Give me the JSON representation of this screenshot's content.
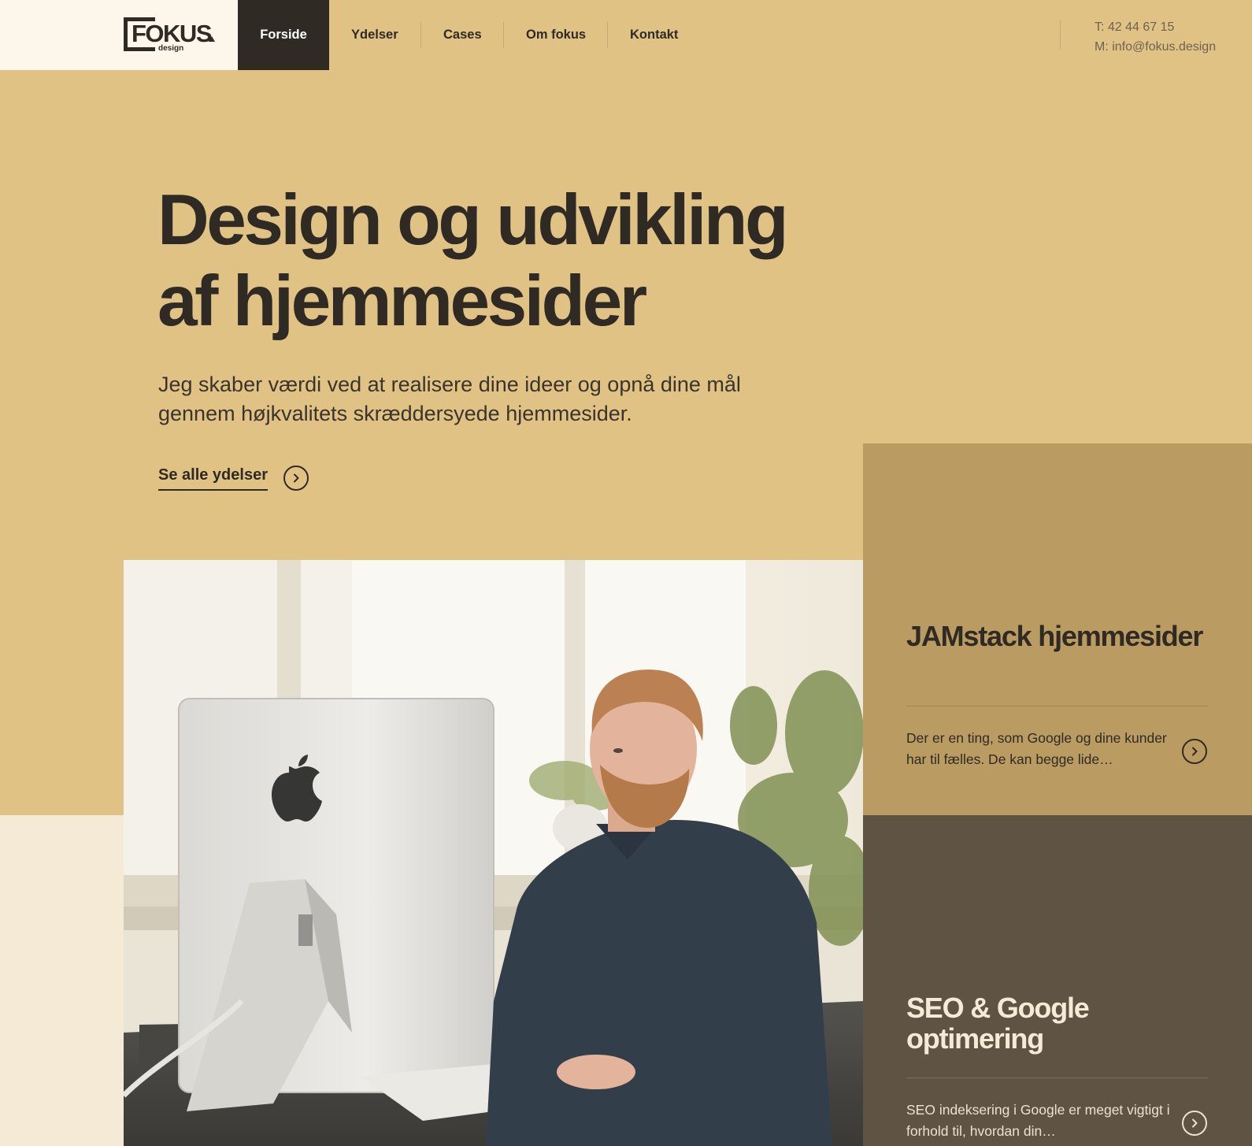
{
  "brand": {
    "logo_text": "FOKUS",
    "logo_sub": "design",
    "colors": {
      "gold": "#e1c285",
      "dark": "#2f2a24",
      "cream": "#fdf6ea",
      "card_gold": "#ba9c63",
      "card_dark": "#5f5444"
    }
  },
  "nav": {
    "items": [
      {
        "label": "Forside",
        "active": true
      },
      {
        "label": "Ydelser",
        "active": false
      },
      {
        "label": "Cases",
        "active": false
      },
      {
        "label": "Om fokus",
        "active": false
      },
      {
        "label": "Kontakt",
        "active": false
      }
    ]
  },
  "contact": {
    "phone": "T: 42 44 67 15",
    "email": "M: info@fokus.design"
  },
  "hero": {
    "title_line1": "Design og udvikling",
    "title_line2": "af hjemmesider",
    "subtitle": "Jeg skaber værdi ved at realisere dine ideer og opnå dine mål gennem højkvalitets skræddersyede hjemmesider.",
    "cta_label": "Se alle ydelser",
    "cta_icon": "chevron-right-icon"
  },
  "photo": {
    "subject": "man-working-at-imac-photo"
  },
  "services": [
    {
      "title": "JAMstack hjemmesider",
      "text": "Der er en ting, som Google og dine kunder har til fælles. De kan begge lide…",
      "icon": "chevron-right-icon"
    },
    {
      "title": "SEO & Google optimering",
      "text": "SEO indeksering i Google er meget vigtigt i forhold til, hvordan din…",
      "icon": "chevron-right-icon"
    }
  ]
}
